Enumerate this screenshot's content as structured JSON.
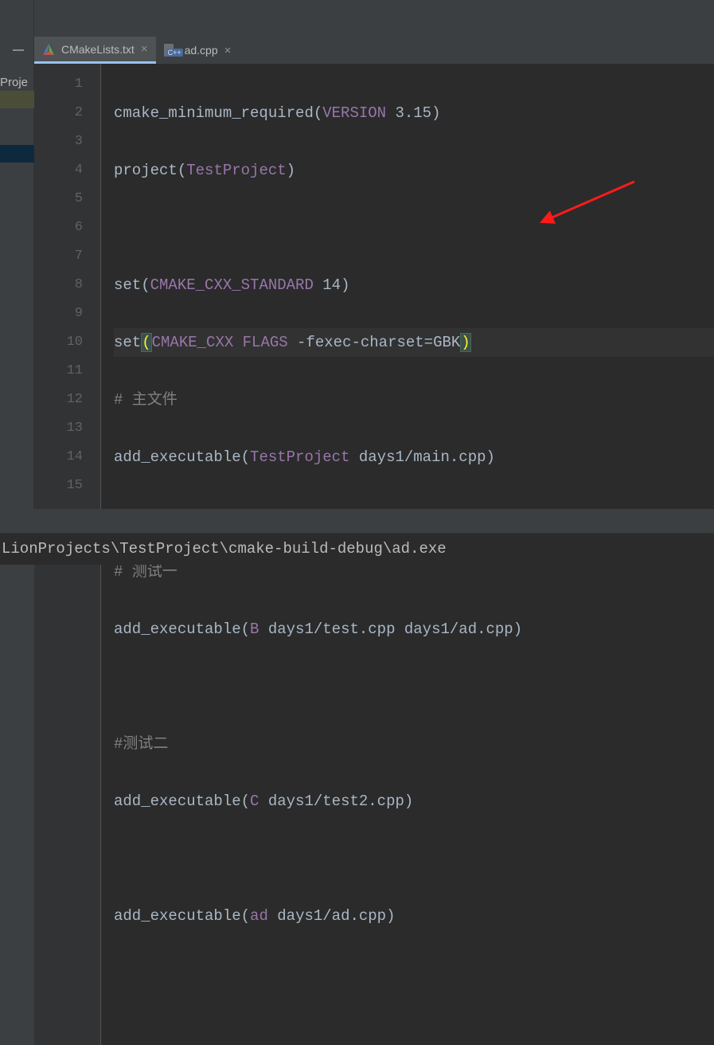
{
  "sidebar": {
    "label": "Proje"
  },
  "tabs": [
    {
      "name": "CMakeLists.txt",
      "active": true
    },
    {
      "name": "ad.cpp",
      "active": false
    }
  ],
  "lines": {
    "l1": {
      "fn": "cmake_minimum_required",
      "arg1": "VERSION",
      "arg2": " 3.15"
    },
    "l2": {
      "fn": "project",
      "arg": "TestProject"
    },
    "l4": {
      "fn": "set",
      "arg1": "CMAKE_CXX_STANDARD",
      "arg2": " 14"
    },
    "l5": {
      "fn": "set",
      "arg1": "CMAKE_CXX FLAGS",
      "arg2": " -fexec-charset=GBK"
    },
    "l6": "# 主文件",
    "l7": {
      "fn": "add_executable",
      "arg1": "TestProject",
      "arg2": " days1/main.cpp"
    },
    "l9": "# 测试一",
    "l10": {
      "fn": "add_executable",
      "arg1": "B",
      "arg2": " days1/test.cpp days1/ad.cpp"
    },
    "l12": "#测试二",
    "l13": {
      "fn": "add_executable",
      "arg1": "C",
      "arg2": " days1/test2.cpp"
    },
    "l15": {
      "fn": "add_executable",
      "arg1": "ad",
      "arg2": " days1/ad.cpp"
    }
  },
  "gutter": [
    "1",
    "2",
    "3",
    "4",
    "5",
    "6",
    "7",
    "8",
    "9",
    "10",
    "11",
    "12",
    "13",
    "14",
    "15"
  ],
  "terminal": "LionProjects\\TestProject\\cmake-build-debug\\ad.exe"
}
